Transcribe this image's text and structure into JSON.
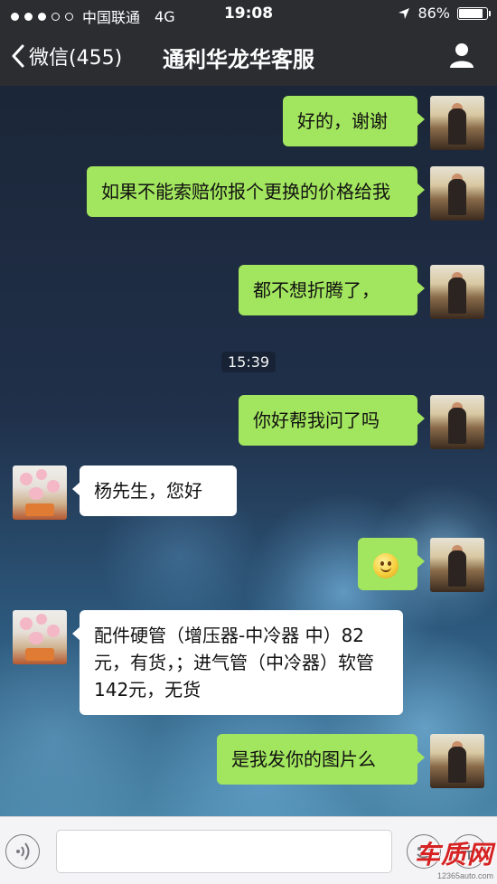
{
  "status_bar": {
    "carrier": "中国联通",
    "network": "4G",
    "time": "19:08",
    "battery": "86%",
    "battery_level": 0.86
  },
  "nav": {
    "back_label": "微信(455)",
    "title": "通利华龙华客服"
  },
  "messages": [
    {
      "from": "me",
      "text": "好的，谢谢"
    },
    {
      "from": "me",
      "text": "如果不能索赔你报个更换的价格给我"
    },
    {
      "from": "me",
      "text": "都不想折腾了，"
    },
    {
      "type": "time",
      "text": "15:39"
    },
    {
      "from": "me",
      "text": "你好帮我问了吗"
    },
    {
      "from": "them",
      "text": "杨先生，您好"
    },
    {
      "from": "me",
      "type": "emoji",
      "emoji": "smile-emoji"
    },
    {
      "from": "them",
      "text": "配件硬管（增压器-中冷器 中）82元，有货，；进气管（中冷器）软管 142元，无货"
    },
    {
      "from": "me",
      "text": "是我发你的图片么"
    }
  ],
  "watermark": {
    "brand": "车质网",
    "url": "12365auto.com"
  },
  "colors": {
    "my_bubble": "#a2e55e",
    "their_bubble": "#ffffff",
    "nav_bg": "#2b2d31"
  }
}
